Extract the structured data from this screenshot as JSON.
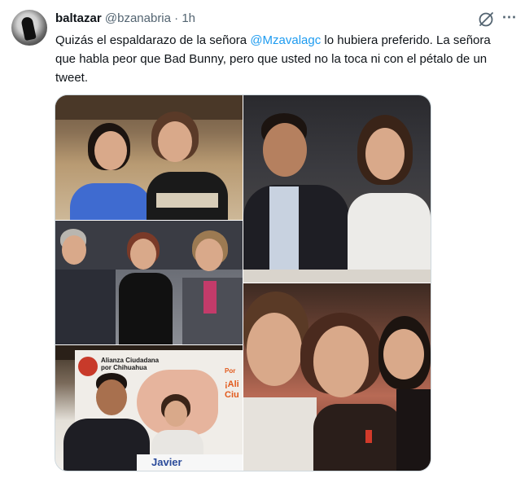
{
  "tweet": {
    "display_name": "baltazar",
    "handle": "@bzanabria",
    "separator": "·",
    "time": "1h",
    "text_part1": "Quizás el espaldarazo de la señora ",
    "mention": "@Mzavalagc",
    "text_part2": "  lo hubiera preferido. La señora que habla peor que Bad Bunny, pero que usted no la toca ni con el pétalo de un tweet.",
    "more_icon": "⋯"
  },
  "media": {
    "sign_text": {
      "alliance": "Alianza Ciudadana por Chihuahua",
      "banner": "¡Ali Ciu",
      "banner_top": "Por",
      "podium": "Javier"
    }
  },
  "colors": {
    "accent": "#1d9bf0",
    "secondary_text": "#536471",
    "border": "#cfd9de"
  },
  "icons": [
    "grok-icon",
    "more-icon",
    "avatar"
  ]
}
